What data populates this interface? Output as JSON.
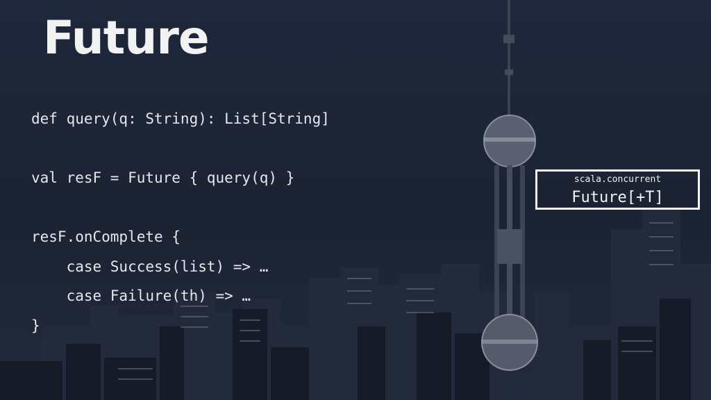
{
  "slide": {
    "title": "Future",
    "code_lines": [
      "def query(q: String): List[String]",
      "",
      "val resF = Future { query(q) }",
      "",
      "resF.onComplete {",
      "    case Success(list) => …",
      "    case Failure(th) => …",
      "}"
    ],
    "badge": {
      "package": "scala.concurrent",
      "type": "Future[+T]"
    }
  }
}
